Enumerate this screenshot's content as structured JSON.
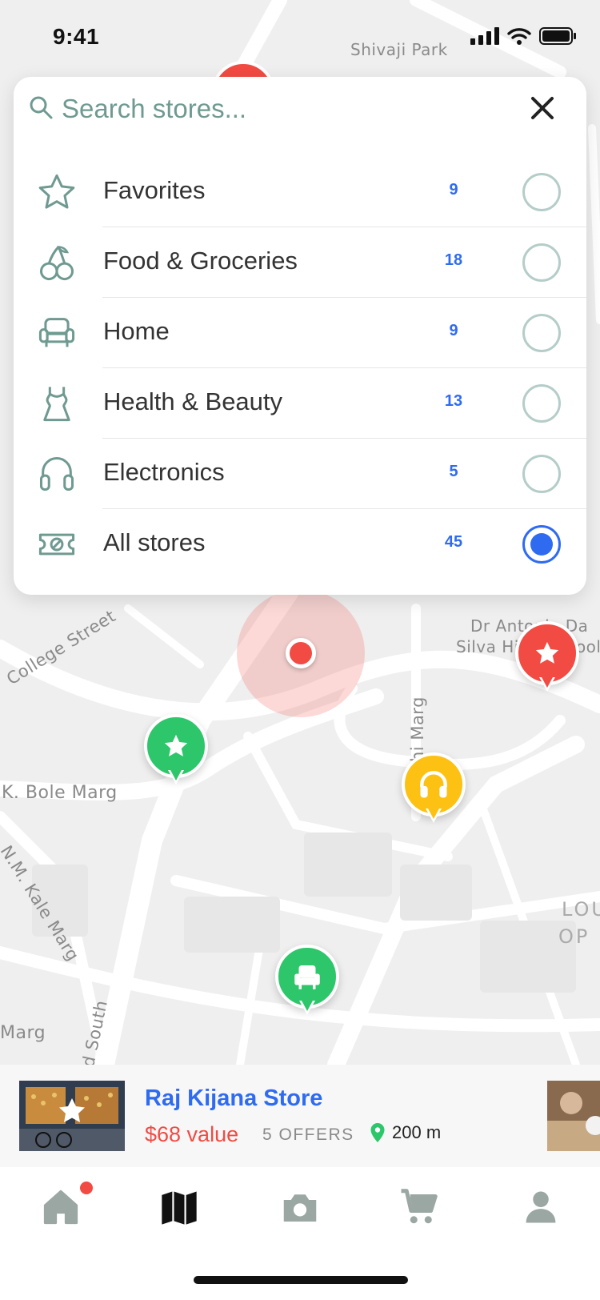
{
  "status_bar": {
    "time": "9:41"
  },
  "map": {
    "labels": {
      "shivaji_park": "Shivaji Park",
      "college_street": "College Street",
      "bole_marg": "K. Bole Marg",
      "kale_marg": "N.M. Kale Marg",
      "marg_left": "Marg",
      "south": "d South",
      "gandhi_marg": "hi Marg",
      "school_line1": "Dr Antonio Da",
      "school_line2": "Silva High School",
      "lou": "LOU",
      "op": "OP"
    }
  },
  "search": {
    "placeholder": "Search stores...",
    "categories": [
      {
        "icon": "star-icon",
        "label": "Favorites",
        "count": "9",
        "selected": false
      },
      {
        "icon": "cherries-icon",
        "label": "Food & Groceries",
        "count": "18",
        "selected": false
      },
      {
        "icon": "armchair-icon",
        "label": "Home",
        "count": "9",
        "selected": false
      },
      {
        "icon": "dress-icon",
        "label": "Health & Beauty",
        "count": "13",
        "selected": false
      },
      {
        "icon": "headphones-icon",
        "label": "Electronics",
        "count": "5",
        "selected": false
      },
      {
        "icon": "ticket-icon",
        "label": "All stores",
        "count": "45",
        "selected": true
      }
    ]
  },
  "markers": [
    {
      "type": "favorite",
      "icon": "star-icon",
      "color": "#f14b43"
    },
    {
      "type": "favorite",
      "icon": "star-icon",
      "color": "#2ec66b"
    },
    {
      "type": "electronics",
      "icon": "headphones-icon",
      "color": "#fcc113"
    },
    {
      "type": "home",
      "icon": "armchair-icon",
      "color": "#2ec66b"
    }
  ],
  "store_card": {
    "name": "Raj Kijana Store",
    "value": "$68 value",
    "offers": "5 OFFERS",
    "distance": "200 m"
  },
  "tabbar": {
    "tabs": [
      {
        "icon": "home-icon",
        "active": false,
        "badge": true
      },
      {
        "icon": "map-icon",
        "active": true,
        "badge": false
      },
      {
        "icon": "camera-icon",
        "active": false,
        "badge": false
      },
      {
        "icon": "cart-icon",
        "active": false,
        "badge": false
      },
      {
        "icon": "profile-icon",
        "active": false,
        "badge": false
      }
    ]
  },
  "colors": {
    "accent_blue": "#2f6bf1",
    "accent_red": "#f14b43",
    "green": "#2ec66b",
    "yellow": "#fcc113",
    "icon_teal": "#6f9a91"
  }
}
